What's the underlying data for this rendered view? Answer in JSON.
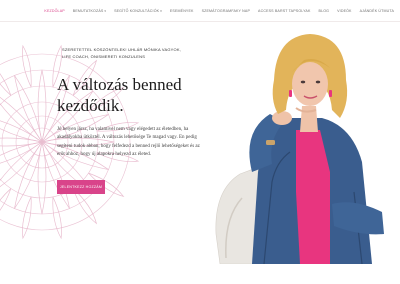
{
  "nav": {
    "items": [
      {
        "label": "Kezdőlap",
        "active": true,
        "caret": false
      },
      {
        "label": "Bemutatkozás",
        "active": false,
        "caret": true
      },
      {
        "label": "Segítő konzultációk",
        "active": false,
        "caret": true
      },
      {
        "label": "Események",
        "active": false,
        "caret": false
      },
      {
        "label": "Szemátogramfaky nap",
        "active": false,
        "caret": false
      },
      {
        "label": "Access Barst tapsolyak",
        "active": false,
        "caret": false
      },
      {
        "label": "Blog",
        "active": false,
        "caret": false
      },
      {
        "label": "Videók",
        "active": false,
        "caret": false
      },
      {
        "label": "Ajándék útmuta",
        "active": false,
        "caret": false
      }
    ],
    "caret_glyph": "▾"
  },
  "hero": {
    "tagline_line1": "Szeretettel köszöntelek! Uhlár Mónika vagyok,",
    "tagline_line2": "life coach, önismereti konzulens",
    "headline_line1": "A változás benned",
    "headline_line2": "kezdődik.",
    "intro": "Jó helyen jársz, ha valamivel nem vagy elégedett az életedben, ha akadályokba ütköztél. A változás lehetősége Te magad vagy. En pedig segíteni tudok abban, hogy felfedezd a benned rejlő lehetőségeket és az erőt ahhoz, hogy új alapokra helyezd az életed.",
    "cta_label": "Jelentkezz hozzám"
  },
  "colors": {
    "accent": "#d9448a",
    "mandala": "#e7b8cc",
    "jacket": "#3a5d8e",
    "hair": "#e2b45a"
  }
}
